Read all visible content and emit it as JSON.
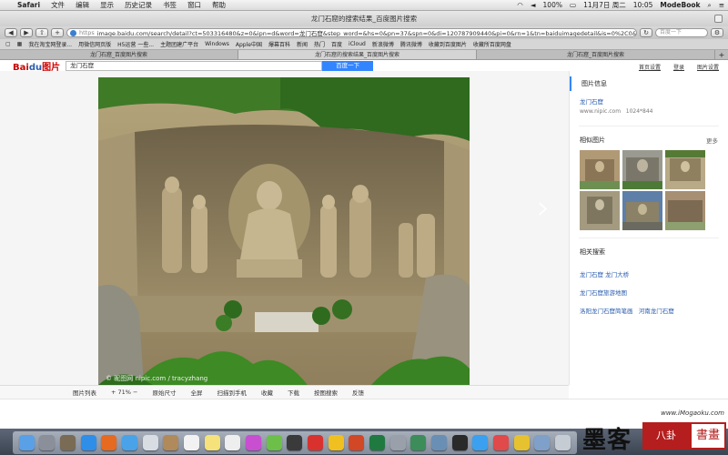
{
  "menubar": {
    "app": "Safari",
    "items": [
      "文件",
      "编辑",
      "显示",
      "历史记录",
      "书签",
      "窗口",
      "帮助"
    ],
    "battery": "100%",
    "date": "11月7日 周二",
    "time": "10:05",
    "user": "ModeBook"
  },
  "window": {
    "title": "龙门石窟的搜索结果_百度图片搜索"
  },
  "toolbar": {
    "url_prefix": "https",
    "url": "image.baidu.com/search/detail?ct=503316480&z=0&ipn=d&word=龙门石窟&step_word=&hs=0&pn=37&spn=0&di=120787909440&pi=0&rn=1&tn=baiduimagedetail&is=0%2C0&ist",
    "search_placeholder": "百度一下"
  },
  "bookmarks": [
    "我在淘宝网登录...",
    "用微信网页版",
    "H5运营 一些...",
    "主题团建广平台",
    "Windows",
    "Apple中国",
    "爆幕百科",
    "新闻",
    "热门",
    "百度",
    "iCloud",
    "新浪微博",
    "腾讯微博",
    "收藏到百度图片",
    "收藏所百度网盘"
  ],
  "tabs": [
    {
      "label": "龙门石窟_百度图片搜索",
      "active": false
    },
    {
      "label": "龙门石窟的搜索结果_百度图片搜索",
      "active": true
    },
    {
      "label": "龙门石窟_百度图片搜索",
      "active": false
    }
  ],
  "baidu": {
    "logo_a": "Bai",
    "logo_b": "du",
    "logo_c": "图片",
    "query": "龙门石窟",
    "search_button": "百度一下",
    "links": [
      "首页设置",
      "登录",
      "图片设置"
    ]
  },
  "photo": {
    "watermark": "© 昵图网 nipic.com / tracyzhang"
  },
  "sidebar": {
    "info_title": "图片信息",
    "image_name": "龙门石窟",
    "source": "www.nipic.com",
    "size": "1024*844",
    "similar_title": "相似图片",
    "more": "更多",
    "related_title": "相关搜索",
    "related": [
      "龙门石窟 龙门大桥",
      "龙门石窟旅游地图",
      "洛阳龙门石窟简笔画",
      "河南龙门石窟"
    ]
  },
  "bottombar": {
    "list": "图片列表",
    "zoom": "71%",
    "original": "原始尺寸",
    "fullscreen": "全屏",
    "phone": "扫描到手机",
    "favorite": "收藏",
    "download": "下载",
    "search_by_image": "按图搜索",
    "feedback": "反馈"
  },
  "brand": {
    "url": "www.iMogaoku.com",
    "name": "墨客",
    "seal": "八卦",
    "seal2": "書畫"
  },
  "colors": {
    "accent": "#3385ff",
    "baidu_red": "#cc0000",
    "seal": "#b51e1e"
  }
}
